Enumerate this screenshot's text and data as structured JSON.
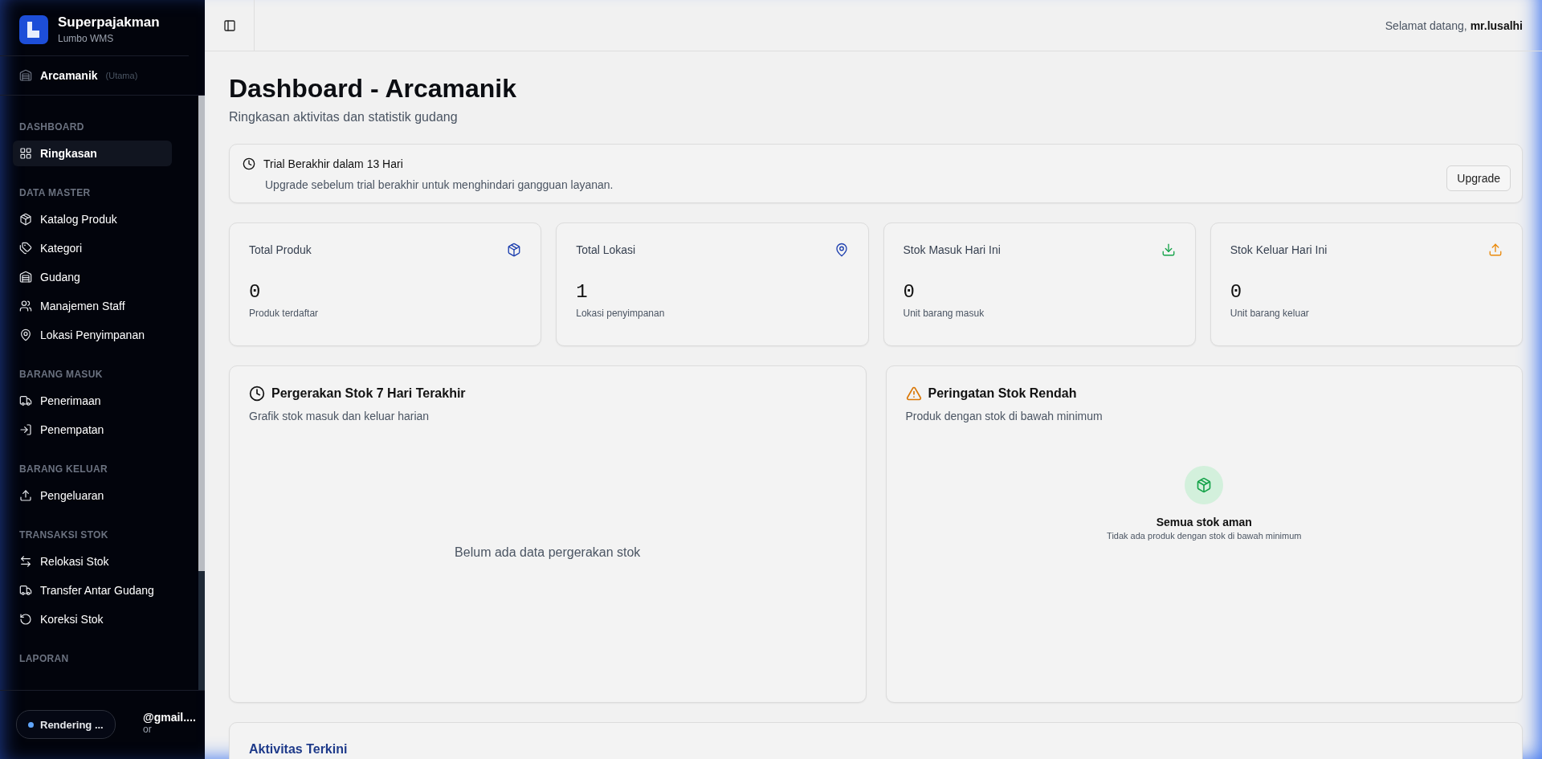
{
  "sidebar": {
    "brand": {
      "name": "Superpajakman",
      "subtitle": "Lumbo WMS"
    },
    "location": {
      "name": "Arcamanik",
      "note": "(Utama)"
    },
    "sections": [
      {
        "title": "DASHBOARD",
        "items": [
          {
            "label": "Ringkasan",
            "kind": "grid",
            "selected": true
          }
        ]
      },
      {
        "title": "DATA MASTER",
        "items": [
          {
            "label": "Katalog Produk",
            "kind": "package",
            "selected": false
          },
          {
            "label": "Kategori",
            "kind": "tags",
            "selected": false
          },
          {
            "label": "Gudang",
            "kind": "warehouse",
            "selected": false
          },
          {
            "label": "Manajemen Staff",
            "kind": "users",
            "selected": false
          },
          {
            "label": "Lokasi Penyimpanan",
            "kind": "pin",
            "selected": false
          }
        ]
      },
      {
        "title": "BARANG MASUK",
        "items": [
          {
            "label": "Penerimaan",
            "kind": "truck",
            "selected": false
          },
          {
            "label": "Penempatan",
            "kind": "login",
            "selected": false
          }
        ]
      },
      {
        "title": "BARANG KELUAR",
        "items": [
          {
            "label": "Pengeluaran",
            "kind": "upload",
            "selected": false
          }
        ]
      },
      {
        "title": "TRANSAKSI STOK",
        "items": [
          {
            "label": "Relokasi Stok",
            "kind": "swap",
            "selected": false
          },
          {
            "label": "Transfer Antar Gudang",
            "kind": "truck",
            "selected": false
          },
          {
            "label": "Koreksi Stok",
            "kind": "undo",
            "selected": false
          }
        ]
      },
      {
        "title": "LAPORAN"
      }
    ],
    "user": {
      "email": "@gmail....",
      "role": "or"
    },
    "badge": {
      "label": "Rendering ..."
    }
  },
  "header": {
    "greeting": "Selamat datang,",
    "user": "mr.lusalhi"
  },
  "page": {
    "title": "Dashboard - Arcamanik",
    "subtitle": "Ringkasan aktivitas dan statistik gudang"
  },
  "trial": {
    "title": "Trial Berakhir dalam 13 Hari",
    "message": "Upgrade sebelum trial berakhir untuk menghindari gangguan layanan.",
    "button": "Upgrade"
  },
  "stats": [
    {
      "label": "Total Produk",
      "value": "0",
      "caption": "Produk terdaftar",
      "kind": "package",
      "color": "#1e40af"
    },
    {
      "label": "Total Lokasi",
      "value": "1",
      "caption": "Lokasi penyimpanan",
      "kind": "pin",
      "color": "#1e40af"
    },
    {
      "label": "Stok Masuk Hari Ini",
      "value": "0",
      "caption": "Unit barang masuk",
      "kind": "download",
      "color": "#16a34a"
    },
    {
      "label": "Stok Keluar Hari Ini",
      "value": "0",
      "caption": "Unit barang keluar",
      "kind": "upload",
      "color": "#ea8a0c"
    }
  ],
  "movement": {
    "title": "Pergerakan Stok 7 Hari Terakhir",
    "subtitle": "Grafik stok masuk dan keluar harian",
    "empty": "Belum ada data pergerakan stok"
  },
  "low_stock": {
    "title": "Peringatan Stok Rendah",
    "subtitle": "Produk dengan stok di bawah minimum",
    "empty_title": "Semua stok aman",
    "empty_text": "Tidak ada produk dengan stok di bawah minimum"
  },
  "activity": {
    "title": "Aktivitas Terkini"
  }
}
